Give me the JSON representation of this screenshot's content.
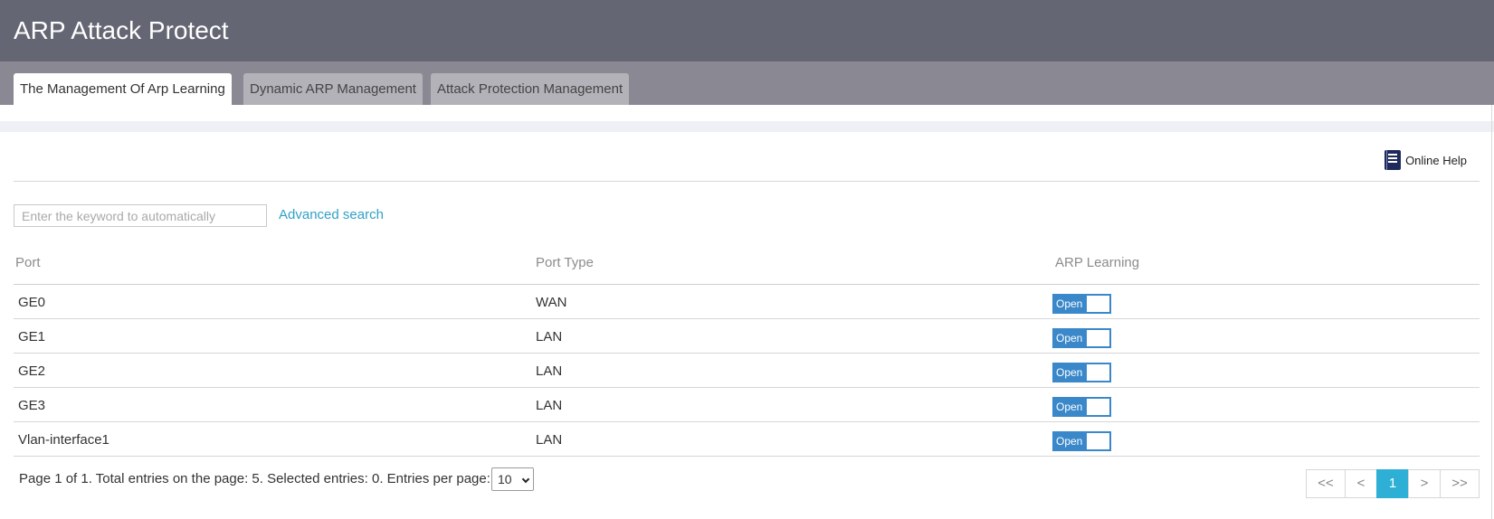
{
  "header": {
    "title": "ARP Attack Protect"
  },
  "tabs": [
    {
      "label": "The Management Of Arp Learning",
      "active": true
    },
    {
      "label": "Dynamic ARP Management",
      "active": false
    },
    {
      "label": "Attack Protection Management",
      "active": false
    }
  ],
  "help": {
    "label": "Online Help",
    "icon": "book-icon"
  },
  "search": {
    "placeholder": "Enter the keyword to automatically",
    "value": "",
    "advanced_label": "Advanced search"
  },
  "table": {
    "columns": [
      "Port",
      "Port Type",
      "ARP Learning"
    ],
    "rows": [
      {
        "port": "GE0",
        "type": "WAN",
        "learning": "Open"
      },
      {
        "port": "GE1",
        "type": "LAN",
        "learning": "Open"
      },
      {
        "port": "GE2",
        "type": "LAN",
        "learning": "Open"
      },
      {
        "port": "GE3",
        "type": "LAN",
        "learning": "Open"
      },
      {
        "port": "Vlan-interface1",
        "type": "LAN",
        "learning": "Open"
      }
    ]
  },
  "footer": {
    "summary": "Page 1 of 1. Total entries on the page: 5. Selected entries: 0. Entries per page:",
    "per_page": "10"
  },
  "pagination": {
    "first": "<<",
    "prev": "<",
    "current": "1",
    "next": ">",
    "last": ">>"
  },
  "colors": {
    "header_bg": "#646673",
    "tabbar_bg": "#8a8893",
    "accent": "#3a88c9",
    "link": "#31a1c6",
    "page_active": "#2eb0d6"
  }
}
